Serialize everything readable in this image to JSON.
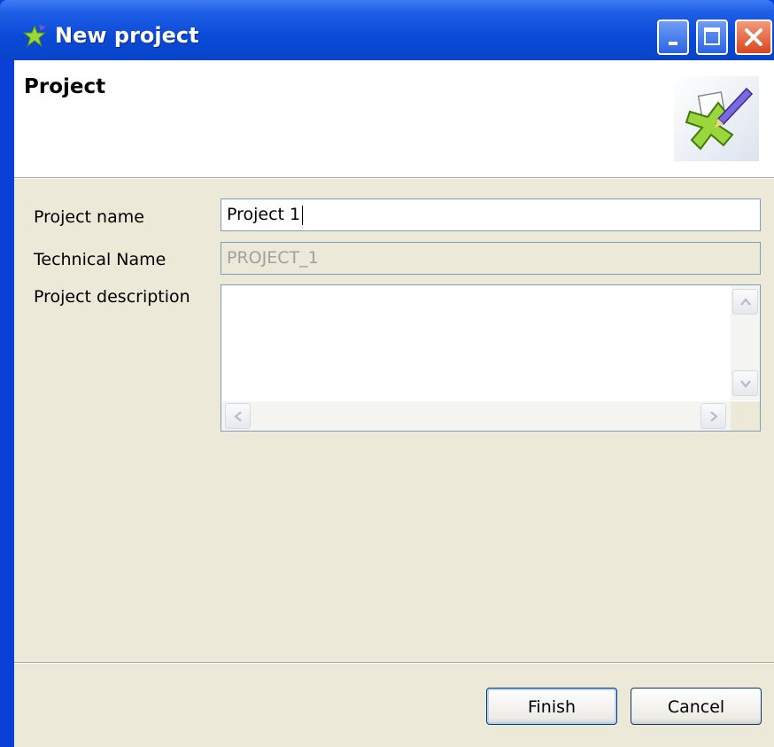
{
  "window": {
    "title": "New project",
    "controls": {
      "minimize": "minimize",
      "maximize": "maximize",
      "close": "close"
    }
  },
  "header": {
    "title": "Project",
    "icon": "talend-wizard-icon"
  },
  "form": {
    "project_name": {
      "label": "Project name",
      "value": "Project 1"
    },
    "technical_name": {
      "label": "Technical Name",
      "value": "PROJECT_1",
      "enabled": false
    },
    "description": {
      "label": "Project description",
      "value": ""
    }
  },
  "buttons": {
    "finish": "Finish",
    "cancel": "Cancel"
  },
  "colors": {
    "titlebar": "#0a4ad8",
    "dialog_bg": "#ece9d8",
    "field_border": "#7f9db9",
    "button_border": "#003c74"
  }
}
